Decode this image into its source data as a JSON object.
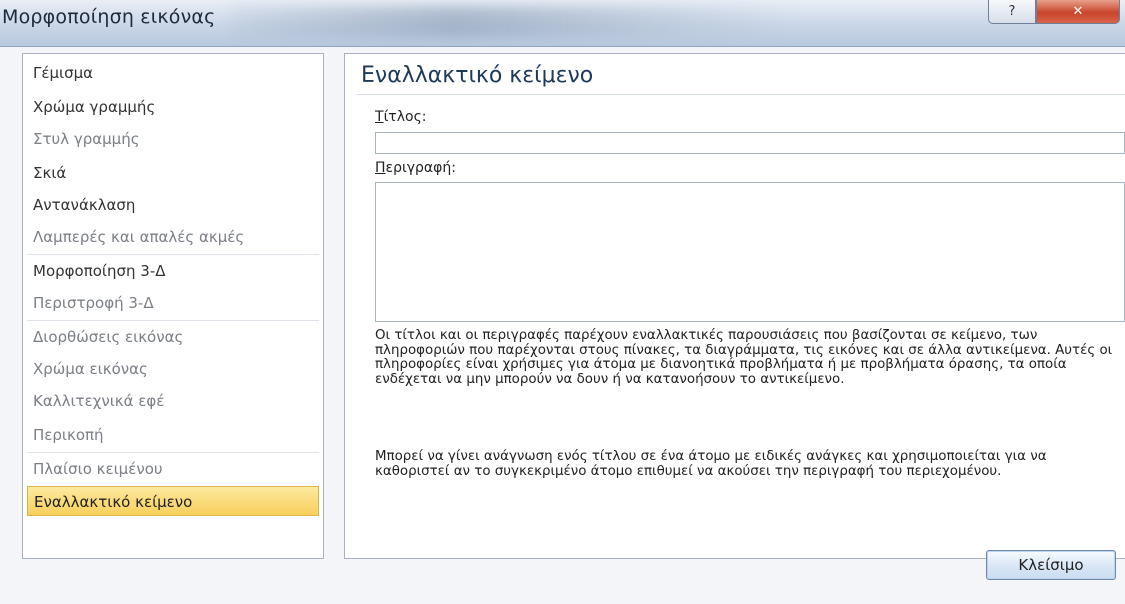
{
  "window": {
    "title": "Μορφοποίηση εικόνας",
    "help_label": "?",
    "close_label": "✕"
  },
  "nav": {
    "items": [
      {
        "label": "Γέμισμα"
      },
      {
        "label": "Χρώμα γραμμής"
      },
      {
        "label": "Στυλ γραμμής"
      },
      {
        "label": "Σκιά"
      },
      {
        "label": "Αντανάκλαση"
      },
      {
        "label": "Λαμπερές και απαλές ακμές"
      },
      {
        "label": "Μορφοποίηση 3-Δ"
      },
      {
        "label": "Περιστροφή 3-Δ"
      },
      {
        "label": "Διορθώσεις εικόνας"
      },
      {
        "label": "Χρώμα εικόνας"
      },
      {
        "label": "Καλλιτεχνικά εφέ"
      },
      {
        "label": "Περικοπή"
      },
      {
        "label": "Πλαίσιο κειμένου"
      },
      {
        "label": "Εναλλακτικό κείμενο"
      }
    ],
    "selected": "Εναλλακτικό κείμενο"
  },
  "content": {
    "heading": "Εναλλακτικό κείμενο",
    "title_label_first": "Τ",
    "title_label_rest": "ίτλος:",
    "title_value": "",
    "description_label_first": "Π",
    "description_label_rest": "εριγραφή:",
    "description_value": "",
    "info_paragraph_1": "Οι τίτλοι και οι περιγραφές παρέχουν εναλλακτικές παρουσιάσεις που βασίζονται σε κείμενο, των πληροφοριών που παρέχονται στους πίνακες, τα διαγράμματα, τις εικόνες και σε άλλα αντικείμενα. Αυτές οι πληροφορίες είναι χρήσιμες για άτομα με διανοητικά προβλήματα ή με προβλήματα όρασης, τα οποία ενδέχεται να μην μπορούν να δουν ή να κατανοήσουν το αντικείμενο.",
    "info_paragraph_2": "Μπορεί να γίνει ανάγνωση ενός τίτλου σε ένα άτομο με ειδικές ανάγκες και χρησιμοποιείται για να καθοριστεί αν το συγκεκριμένο άτομο επιθυμεί να ακούσει την περιγραφή του περιεχομένου."
  },
  "footer": {
    "close_button": "Κλείσιμο"
  },
  "colors": {
    "selected_item": "#f8cf5a",
    "heading": "#1e3a5a",
    "titlebar_close": "#c9452b"
  }
}
